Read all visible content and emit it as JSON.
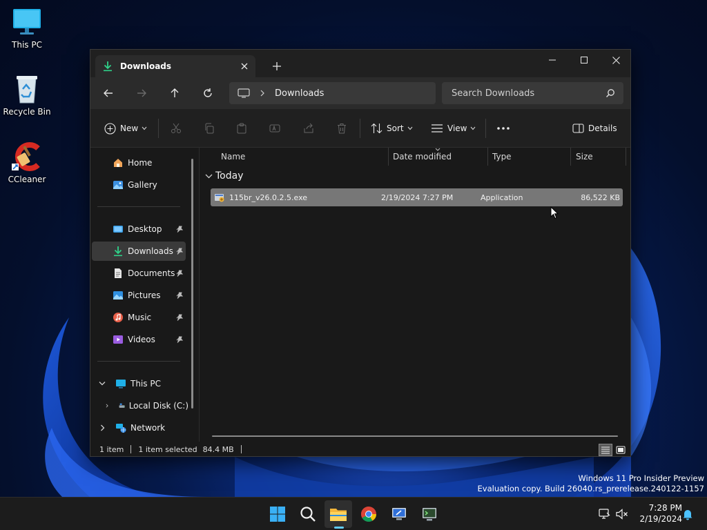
{
  "desktop": {
    "icons": [
      {
        "label": "This PC",
        "icon": "this-pc-icon"
      },
      {
        "label": "Recycle Bin",
        "icon": "recycle-bin-icon"
      },
      {
        "label": "CCleaner",
        "icon": "ccleaner-icon"
      }
    ],
    "watermark": {
      "line1": "Windows 11 Pro Insider Preview",
      "line2": "Evaluation copy. Build 26040.rs_prerelease.240122-1157"
    }
  },
  "explorer": {
    "tab": {
      "title": "Downloads",
      "icon": "download-icon"
    },
    "address": {
      "crumb": "Downloads"
    },
    "search": {
      "placeholder": "Search Downloads"
    },
    "commands": {
      "new_label": "New",
      "sort_label": "Sort",
      "view_label": "View",
      "details_label": "Details"
    },
    "sidebar": {
      "quick": [
        {
          "label": "Home",
          "icon": "home-icon"
        },
        {
          "label": "Gallery",
          "icon": "gallery-icon"
        }
      ],
      "pinned": [
        {
          "label": "Desktop",
          "icon": "desktop-folder-icon",
          "pinned": true
        },
        {
          "label": "Downloads",
          "icon": "download-icon",
          "pinned": true,
          "selected": true
        },
        {
          "label": "Documents",
          "icon": "documents-icon",
          "pinned": true
        },
        {
          "label": "Pictures",
          "icon": "pictures-icon",
          "pinned": true
        },
        {
          "label": "Music",
          "icon": "music-icon",
          "pinned": true
        },
        {
          "label": "Videos",
          "icon": "videos-icon",
          "pinned": true
        }
      ],
      "tree": [
        {
          "label": "This PC",
          "icon": "this-pc-icon",
          "expanded": true
        },
        {
          "label": "Local Disk (C:)",
          "icon": "drive-icon",
          "expanded": false
        },
        {
          "label": "Network",
          "icon": "network-icon",
          "expanded": false
        }
      ]
    },
    "columns": [
      "Name",
      "Date modified",
      "Type",
      "Size"
    ],
    "group": "Today",
    "files": [
      {
        "name": "115br_v26.0.2.5.exe",
        "date": "2/19/2024 7:27 PM",
        "type": "Application",
        "size": "86,522 KB",
        "selected": true
      }
    ],
    "status": {
      "count": "1 item",
      "selection": "1 item selected",
      "size": "84.4 MB"
    }
  },
  "taskbar": {
    "apps": [
      "start-icon",
      "search-icon",
      "file-explorer-icon",
      "chrome-icon",
      "remote-desktop-icon",
      "terminal-icon"
    ],
    "clock": {
      "time": "7:28 PM",
      "date": "2/19/2024"
    }
  },
  "colors": {
    "accent": "#60cdff",
    "window_bg": "#191919",
    "selection": "#777777"
  }
}
